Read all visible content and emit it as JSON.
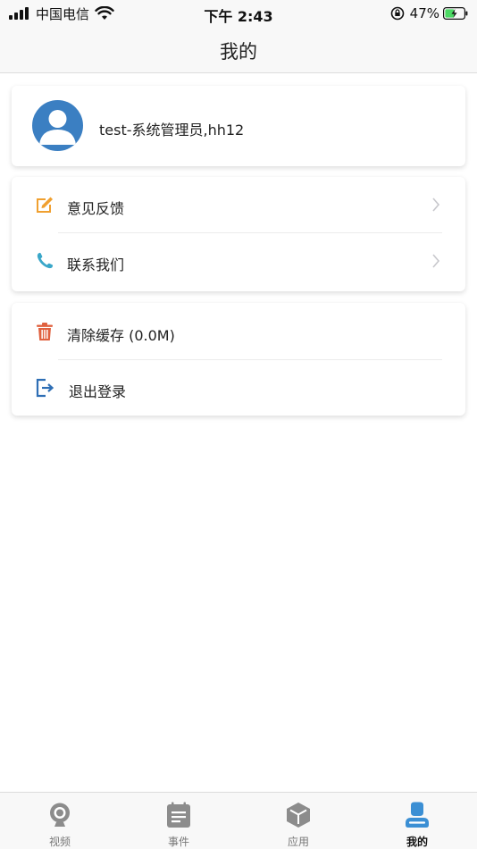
{
  "status_bar": {
    "carrier": "中国电信",
    "time": "下午 2:43",
    "battery": "47%"
  },
  "header": {
    "title": "我的"
  },
  "profile": {
    "name": "test-系统管理员,hh12"
  },
  "menu_group_1": [
    {
      "label": "意见反馈",
      "icon": "edit-icon"
    },
    {
      "label": "联系我们",
      "icon": "phone-icon"
    }
  ],
  "menu_group_2": [
    {
      "label": "清除缓存 (0.0M)",
      "icon": "trash-icon"
    },
    {
      "label": "退出登录",
      "icon": "logout-icon"
    }
  ],
  "tabbar": {
    "tabs": [
      {
        "label": "视频",
        "icon": "camera-icon"
      },
      {
        "label": "事件",
        "icon": "clipboard-icon"
      },
      {
        "label": "应用",
        "icon": "cube-icon"
      },
      {
        "label": "我的",
        "icon": "user-icon"
      }
    ],
    "active": "我的"
  },
  "colors": {
    "accent": "#3b7fc2",
    "edit_icon": "#f0a030",
    "phone_icon": "#3aa7c9",
    "trash_icon": "#e0613f",
    "logout_icon": "#2f6fb5",
    "inactive_tab": "#8c8c8c"
  }
}
